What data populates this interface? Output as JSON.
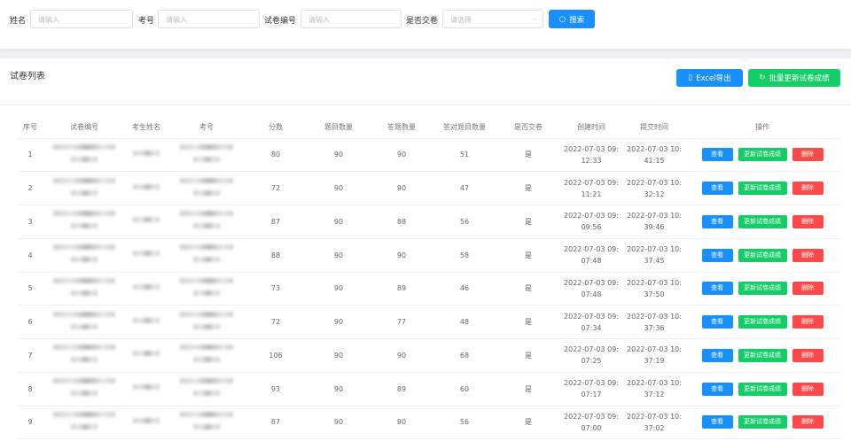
{
  "filters": {
    "name_label": "姓名",
    "name_placeholder": "请输入",
    "exam_no_label": "考号",
    "exam_no_placeholder": "请输入",
    "paper_no_label": "试卷编号",
    "paper_no_placeholder": "请输入",
    "submitted_label": "是否交卷",
    "submitted_placeholder": "请选择",
    "search_label": "搜索"
  },
  "panel": {
    "title": "试卷列表",
    "export_label": "Excel导出",
    "batch_update_label": "批量更新试卷成绩"
  },
  "colors": {
    "primary": "#1890ff",
    "success": "#13ce66",
    "danger": "#ff4949"
  },
  "table": {
    "headers": [
      "序号",
      "试卷编号",
      "考生姓名",
      "考号",
      "分数",
      "题目数量",
      "答题数量",
      "答对题目数量",
      "是否交卷",
      "创建时间",
      "提交时间",
      "操作"
    ],
    "actions": {
      "view": "查看",
      "update": "更新试卷成绩",
      "delete": "删除"
    },
    "rows": [
      {
        "idx": "1",
        "score": "80",
        "total": "90",
        "answered": "90",
        "correct": "51",
        "submitted": "是",
        "created": "2022-07-03 09:12:33",
        "submitted_at": "2022-07-03 10:41:15"
      },
      {
        "idx": "2",
        "score": "72",
        "total": "90",
        "answered": "90",
        "correct": "47",
        "submitted": "是",
        "created": "2022-07-03 09:11:21",
        "submitted_at": "2022-07-03 10:32:12"
      },
      {
        "idx": "3",
        "score": "87",
        "total": "90",
        "answered": "88",
        "correct": "56",
        "submitted": "是",
        "created": "2022-07-03 09:09:56",
        "submitted_at": "2022-07-03 10:39:46"
      },
      {
        "idx": "4",
        "score": "88",
        "total": "90",
        "answered": "90",
        "correct": "58",
        "submitted": "是",
        "created": "2022-07-03 09:07:48",
        "submitted_at": "2022-07-03 10:37:45"
      },
      {
        "idx": "5",
        "score": "73",
        "total": "90",
        "answered": "89",
        "correct": "46",
        "submitted": "是",
        "created": "2022-07-03 09:07:48",
        "submitted_at": "2022-07-03 10:37:50"
      },
      {
        "idx": "6",
        "score": "72",
        "total": "90",
        "answered": "77",
        "correct": "48",
        "submitted": "是",
        "created": "2022-07-03 09:07:34",
        "submitted_at": "2022-07-03 10:37:36"
      },
      {
        "idx": "7",
        "score": "106",
        "total": "90",
        "answered": "90",
        "correct": "68",
        "submitted": "是",
        "created": "2022-07-03 09:07:25",
        "submitted_at": "2022-07-03 10:37:19"
      },
      {
        "idx": "8",
        "score": "93",
        "total": "90",
        "answered": "89",
        "correct": "60",
        "submitted": "是",
        "created": "2022-07-03 09:07:17",
        "submitted_at": "2022-07-03 10:37:12"
      },
      {
        "idx": "9",
        "score": "87",
        "total": "90",
        "answered": "90",
        "correct": "56",
        "submitted": "是",
        "created": "2022-07-03 09:07:00",
        "submitted_at": "2022-07-03 10:37:02"
      }
    ]
  }
}
